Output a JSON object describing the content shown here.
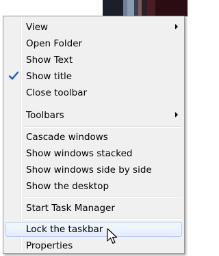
{
  "menu": {
    "items": [
      {
        "label": "View",
        "submenu": true,
        "checked": false,
        "hover": false
      },
      {
        "label": "Open Folder",
        "submenu": false,
        "checked": false,
        "hover": false
      },
      {
        "label": "Show Text",
        "submenu": false,
        "checked": false,
        "hover": false
      },
      {
        "label": "Show title",
        "submenu": false,
        "checked": true,
        "hover": false
      },
      {
        "label": "Close toolbar",
        "submenu": false,
        "checked": false,
        "hover": false
      },
      {
        "label": "Toolbars",
        "submenu": true,
        "checked": false,
        "hover": false
      },
      {
        "label": "Cascade windows",
        "submenu": false,
        "checked": false,
        "hover": false
      },
      {
        "label": "Show windows stacked",
        "submenu": false,
        "checked": false,
        "hover": false
      },
      {
        "label": "Show windows side by side",
        "submenu": false,
        "checked": false,
        "hover": false
      },
      {
        "label": "Show the desktop",
        "submenu": false,
        "checked": false,
        "hover": false
      },
      {
        "label": "Start Task Manager",
        "submenu": false,
        "checked": false,
        "hover": false
      },
      {
        "label": "Lock the taskbar",
        "submenu": false,
        "checked": false,
        "hover": true
      },
      {
        "label": "Properties",
        "submenu": false,
        "checked": false,
        "hover": false
      }
    ]
  },
  "colors": {
    "menu_background": "#f0f0f0",
    "menu_border": "#979797",
    "hover_border": "#aecff7",
    "checkmark": "#1f5fbf"
  },
  "icons": {
    "checkmark": "checkmark-icon",
    "submenu_arrow": "submenu-arrow-icon",
    "cursor": "mouse-pointer-icon"
  }
}
